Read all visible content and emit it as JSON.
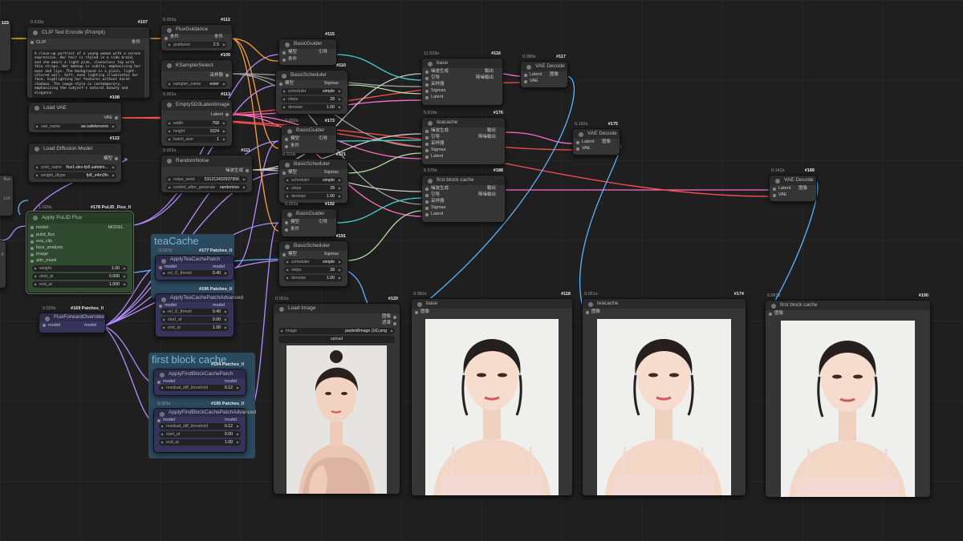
{
  "nodes": {
    "clip": {
      "id": "#107",
      "timer": "0.616s",
      "title": "CLIP Text Encode (Prompt)",
      "in": "CLIP",
      "out": "条件",
      "prompt": "A close-up portrait of a young woman with a serene expression. Her hair is styled in a side braid, and she wears a light pink, sleeveless top with thin straps. Her makeup is subtle, emphasizing her eyes and lips. The background is a plain, light-colored wall. Soft, even lighting illuminates her face, highlighting her features without harsh shadows. The image style is contemporary, emphasizing the subject's natural beauty and elegance."
    },
    "flux_guidance": {
      "id": "#112",
      "timer": "0.001s",
      "title": "FluxGuidance",
      "in": "条件",
      "out": "条件",
      "w_label": "guidance",
      "w_value": "2.5"
    },
    "ksampler_select": {
      "id": "#109",
      "title": "KSamplerSelect",
      "out": "采样器",
      "w_label": "sampler_name",
      "w_value": "euler"
    },
    "empty_latent": {
      "id": "#113",
      "timer": "0.001s",
      "title": "EmptySD3LatentImage",
      "out": "Latent",
      "w1_label": "width",
      "w1_value": "768",
      "w2_label": "height",
      "w2_value": "1024",
      "w3_label": "batch_size",
      "w3_value": "1"
    },
    "random_noise": {
      "id": "#111",
      "timer": "0.001s",
      "title": "RandomNoise",
      "out": "噪波生成",
      "w1_label": "noise_seed",
      "w1_value": "531212432937956",
      "w2_label": "control_after_generate",
      "w2_value": "randomize"
    },
    "load_vae": {
      "id": "#108",
      "title": "Load VAE",
      "out": "VAE",
      "w_label": "vae_name",
      "w_value": "ae.safetensors"
    },
    "load_diffusion": {
      "id": "#122",
      "title": "Load Diffusion Model",
      "out": "模型",
      "w1_label": "unet_name",
      "w1_value": "flux1-dev-fp8.safeten...",
      "w2_label": "weight_dtype",
      "w2_value": "fp8_e4m3fn"
    },
    "apply_pulid": {
      "id": "#178 PuLID_Flux_ll",
      "timer": "1.020s",
      "title": "Apply PuLID Flux",
      "out": "MODEL",
      "inputs": [
        "model",
        "pulid_flux",
        "eva_clip",
        "face_analysis",
        "image",
        "attn_mask"
      ],
      "w1_label": "weight",
      "w1_value": "1.00",
      "w2_label": "start_at",
      "w2_value": "0.000",
      "w3_label": "end_at",
      "w3_value": "1.000"
    },
    "flux_forward": {
      "id": "#169 Patches_ll",
      "timer": "0.020s",
      "title": "FluxForwardOverrider",
      "in": "model",
      "out": "model"
    },
    "basic_guider_115": {
      "id": "#115",
      "title": "BasicGuider",
      "in1": "模型",
      "in2": "条件",
      "out": "引导"
    },
    "basic_scheduler_110": {
      "id": "#110",
      "title": "BasicScheduler",
      "in": "模型",
      "out": "Sigmas",
      "w1_label": "scheduler",
      "w1_value": "simple",
      "w2_label": "steps",
      "w2_value": "28",
      "w3_label": "denoise",
      "w3_value": "1.00"
    },
    "basic_guider_173": {
      "id": "#173",
      "timer": "0.002s",
      "title": "BasicGuider",
      "in1": "模型",
      "in2": "条件",
      "out": "引导"
    },
    "basic_scheduler_171": {
      "id": "#171",
      "timer": "0.010s",
      "title": "BasicScheduler",
      "in": "模型",
      "out": "Sigmas",
      "w1_label": "scheduler",
      "w1_value": "simple",
      "w2_label": "steps",
      "w2_value": "28",
      "w3_label": "denoise",
      "w3_value": "1.00"
    },
    "basic_guider_192": {
      "id": "#192",
      "timer": "0.001s",
      "title": "BasicGuider",
      "in1": "模型",
      "in2": "条件",
      "out": "引导"
    },
    "basic_scheduler_191": {
      "id": "#191",
      "title": "BasicScheduler",
      "in": "模型",
      "out": "Sigmas",
      "w1_label": "scheduler",
      "w1_value": "simple",
      "w2_label": "steps",
      "w2_value": "28",
      "w3_label": "denoise",
      "w3_value": "1.00"
    },
    "sampler_base": {
      "id": "#116",
      "timer": "11.526s",
      "title": "base",
      "inputs": [
        "噪波生成",
        "引导",
        "采样器",
        "Sigmas",
        "Latent"
      ],
      "out1": "輸出",
      "out2": "降噪輸出"
    },
    "sampler_teacache": {
      "id": "#176",
      "timer": "5.618s",
      "title": "teacache",
      "inputs": [
        "噪波生成",
        "引导",
        "采样器",
        "Sigmas",
        "Latent"
      ],
      "out1": "輸出",
      "out2": "降噪輸出"
    },
    "sampler_fbc": {
      "id": "#188",
      "timer": "6.576s",
      "title": "first block cache",
      "inputs": [
        "噪波生成",
        "引导",
        "采样器",
        "Sigmas",
        "Latent"
      ],
      "out1": "輸出",
      "out2": "降噪輸出"
    },
    "vae_decode_117": {
      "id": "#117",
      "timer": "0.089s",
      "title": "VAE Decode",
      "in1": "Latent",
      "in2": "VAE",
      "out": "图像"
    },
    "vae_decode_175": {
      "id": "#175",
      "timer": "0.162s",
      "title": "VAE Decode",
      "in1": "Latent",
      "in2": "VAE",
      "out": "图像"
    },
    "vae_decode_189": {
      "id": "#189",
      "timer": "0.142s",
      "title": "VAE Decode",
      "in1": "Latent",
      "in2": "VAE",
      "out": "图像"
    },
    "load_image": {
      "id": "#120",
      "timer": "0.001s",
      "title": "Load Image",
      "out1": "图像",
      "out2": "遮罩",
      "w_label": "image",
      "w_value": "pasted/image (16).png",
      "upload": "upload"
    },
    "preview_base": {
      "id": "#118",
      "timer": "0.082s",
      "title": "base",
      "in": "图像"
    },
    "preview_teacache": {
      "id": "#174",
      "timer": "0.051s",
      "title": "teacache",
      "in": "图像"
    },
    "preview_fbc": {
      "id": "#190",
      "timer": "0.063s",
      "title": "first block cache",
      "in": "图像"
    },
    "apply_teacache": {
      "id": "#177 Patches_ll",
      "timer": "0.027s",
      "title": "ApplyTeaCachePatch",
      "in": "model",
      "out": "model",
      "w_label": "rel_l1_thresh",
      "w_value": "0.40"
    },
    "apply_teacache_adv": {
      "id": "#196 Patches_ll",
      "title": "ApplyTeaCachePatchAdvanced",
      "in": "model",
      "out": "model",
      "w1_label": "rel_l1_thresh",
      "w1_value": "0.40",
      "w2_label": "start_at",
      "w2_value": "0.00",
      "w3_label": "end_at",
      "w3_value": "1.00"
    },
    "apply_fbc": {
      "id": "#194 Patches_ll",
      "title": "ApplyFirstBlockCachePatch",
      "in": "model",
      "out": "model",
      "w_label": "residual_diff_threshold",
      "w_value": "0.12"
    },
    "apply_fbc_adv": {
      "id": "#195 Patches_ll",
      "timer": "0.001s",
      "title": "ApplyFirstBlockCachePatchAdvanced",
      "in": "model",
      "out": "model",
      "w1_label": "residual_diff_threshold",
      "w1_value": "0.12",
      "w2_label": "start_at",
      "w2_value": "0.00",
      "w3_label": "end_at",
      "w3_value": "1.00"
    }
  },
  "groups": {
    "teacache": "teaCache",
    "first_block_cache": "first block cache"
  },
  "left_edge": {
    "id_fragment": "123",
    "labels": [
      "flux",
      "LIX",
      "ll"
    ]
  },
  "colors": {
    "model": "#b48cff",
    "clip": "#ffd500",
    "conditioning": "#ff9e3a",
    "latent": "#ff6ec7",
    "vae": "#ff5050",
    "image": "#5ab4ff",
    "noise": "#cccccc",
    "guider": "#48d1cc",
    "sigmas": "#b0e0a0",
    "group": "#2b4a5e"
  }
}
